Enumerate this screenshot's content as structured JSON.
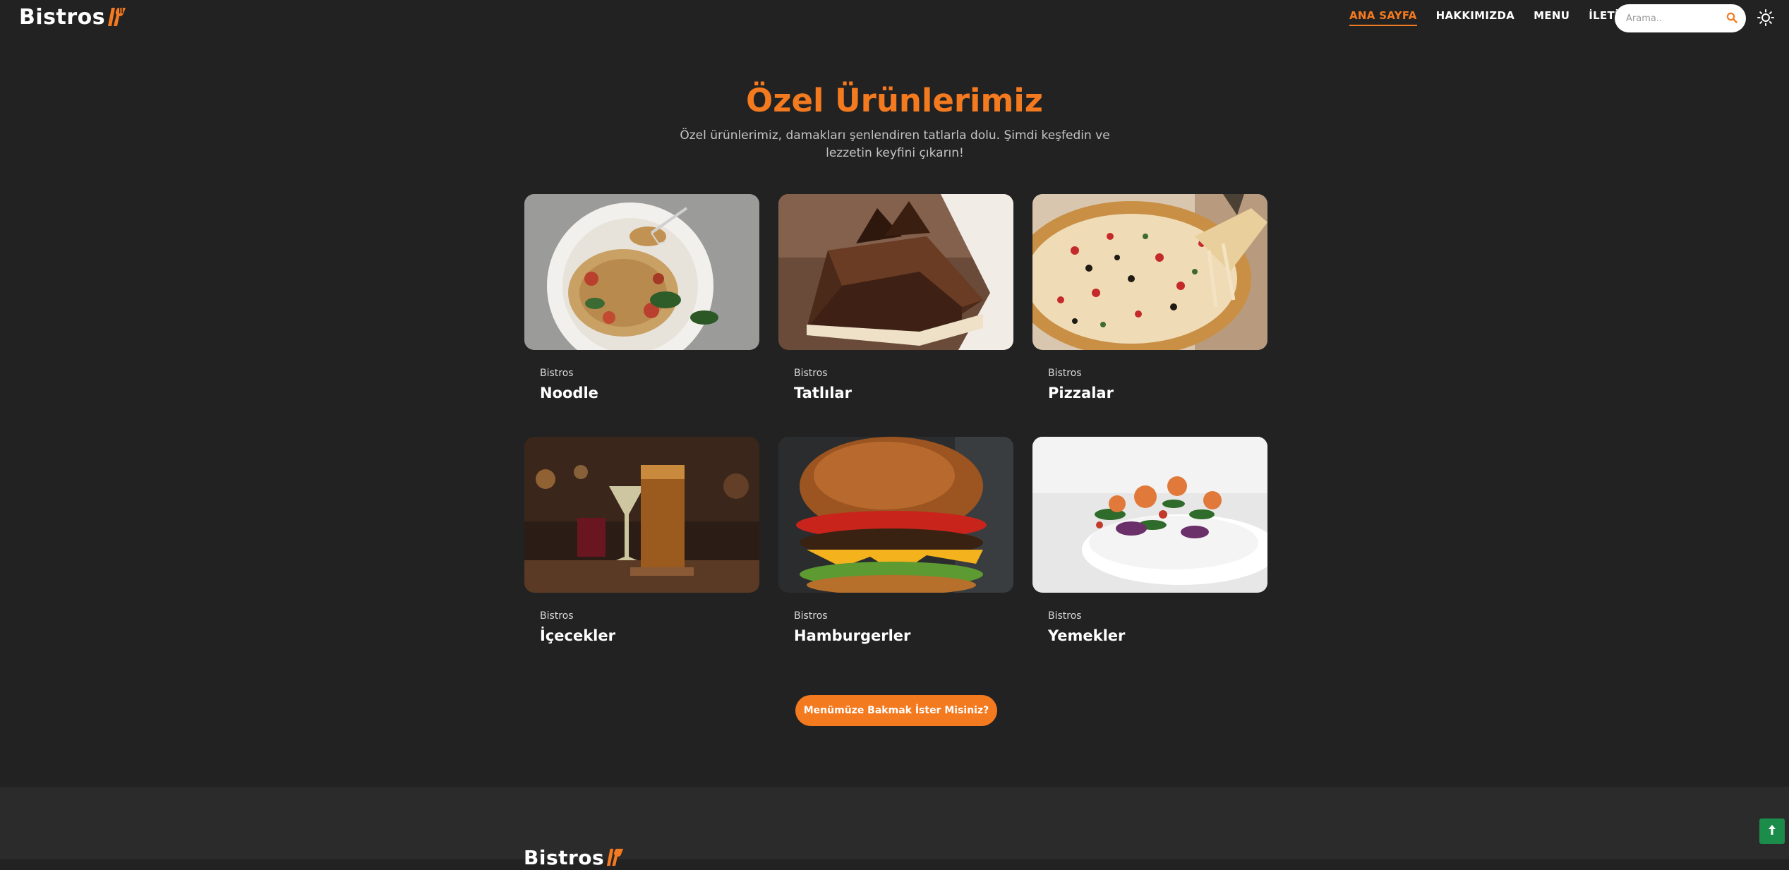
{
  "header": {
    "logo_text": "Bistros",
    "nav": [
      {
        "label": "ANA SAYFA",
        "active": true
      },
      {
        "label": "HAKKIMIZDA",
        "active": false
      },
      {
        "label": "MENU",
        "active": false
      },
      {
        "label": "İLETİŞİM",
        "active": false
      }
    ],
    "search_placeholder": "Arama..",
    "search_icon": "search-icon",
    "theme_icon": "sun-icon"
  },
  "section": {
    "title": "Özel Ürünlerimiz",
    "subtitle": "Özel ürünlerimiz, damakları şenlendiren tatlarla dolu. Şimdi keşfedin ve lezzetin keyfini çıkarın!",
    "cards": [
      {
        "category": "Bistros",
        "title": "Noodle",
        "image": "spaghetti-plate"
      },
      {
        "category": "Bistros",
        "title": "Tatlılar",
        "image": "chocolate-cake-slice"
      },
      {
        "category": "Bistros",
        "title": "Pizzalar",
        "image": "pizza-slice"
      },
      {
        "category": "Bistros",
        "title": "İçecekler",
        "image": "cocktail-drinks"
      },
      {
        "category": "Bistros",
        "title": "Hamburgerler",
        "image": "cheeseburger"
      },
      {
        "category": "Bistros",
        "title": "Yemekler",
        "image": "shrimp-dish"
      }
    ],
    "menu_button": "Menümüze Bakmak İster Misiniz?"
  },
  "footer": {
    "logo_text": "Bistros"
  },
  "back_to_top_icon": "arrow-up-icon",
  "colors": {
    "accent": "#f47a20",
    "background": "#222222",
    "footer": "#2b2b2b",
    "back_to_top": "#1c8c4a"
  }
}
